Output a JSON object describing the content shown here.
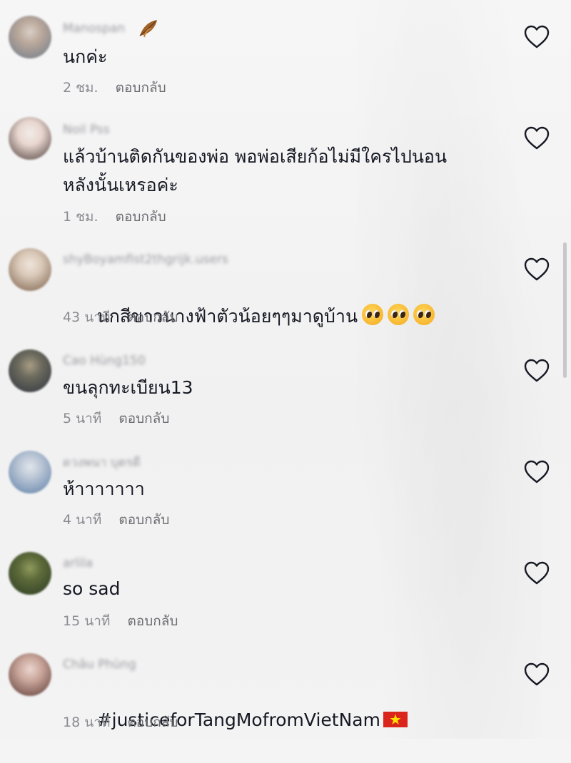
{
  "comments": [
    {
      "username": "Manospan",
      "text": "นกค่ะ",
      "time": "2 ชม.",
      "reply_label": "ตอบกลับ",
      "avatar_colors": [
        "#b9a79a",
        "#6c7a8a",
        "#d8cfc6"
      ]
    },
    {
      "username": "Noil Pss",
      "text": "แล้วบ้านติดกันของพ่อ พอพ่อเสียก้อไม่มีใครไปนอน\nหลังนั้นเหรอค่ะ",
      "time": "1 ชม.",
      "reply_label": "ตอบกลับ",
      "avatar_colors": [
        "#e8d6cf",
        "#4a3a36",
        "#f2ece8"
      ]
    },
    {
      "username": "shyBoyamfist2thgrijk.users",
      "text": "นกสีขาวนางฟ้าตัวน้อยๆๆมาดูบ้าน",
      "time": "43 นาที",
      "reply_label": "ตอบกลับ",
      "emoji": "pleading-face",
      "emoji_count": 3,
      "avatar_colors": [
        "#d9c8b7",
        "#7a5e4a",
        "#efe5dc"
      ]
    },
    {
      "username": "Cao Hùng150",
      "text": "ขนลุกทะเบียน13",
      "time": "5 นาที",
      "reply_label": "ตอบกลับ",
      "avatar_colors": [
        "#6b6a5d",
        "#2f3440",
        "#a99c84"
      ]
    },
    {
      "username": "ดวงพนา บุตรดี",
      "text": "ห้าาาาาาา",
      "time": "4 นาที",
      "reply_label": "ตอบกลับ",
      "avatar_colors": [
        "#b8c4d4",
        "#5d7fa8",
        "#e2e6ec"
      ]
    },
    {
      "username": "arlila",
      "text": "so sad",
      "time": "15 นาที",
      "reply_label": "ตอบกลับ",
      "avatar_colors": [
        "#5c6a3a",
        "#2d3a22",
        "#8f9a5c"
      ]
    },
    {
      "username": "Châu Phùng",
      "text": "#justiceforTangMofromVietNam",
      "time": "18 นาที",
      "reply_label": "ตอบกลับ",
      "emoji": "vietnam-flag",
      "avatar_colors": [
        "#c9a59a",
        "#5a3a35",
        "#ead6cf"
      ]
    }
  ],
  "colors": {
    "background": "#f4f4f4",
    "text": "#161823",
    "meta": "#8a8b91",
    "heart_stroke": "#161823"
  },
  "icons": [
    "heart-outline-icon",
    "leaf-icon",
    "pleading-face-emoji",
    "vietnam-flag-emoji"
  ]
}
